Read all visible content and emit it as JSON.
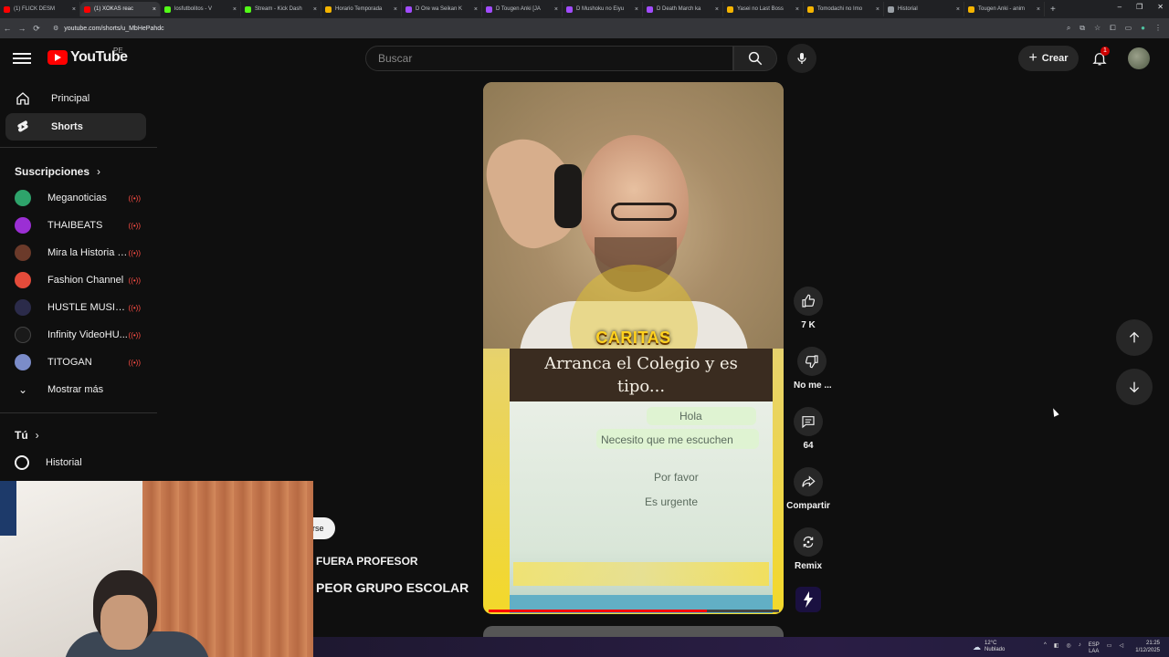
{
  "browser": {
    "tabs": [
      {
        "label": "(1) FLICK DESM",
        "color": "#ff0000"
      },
      {
        "label": "(1) XOKAS reac",
        "color": "#ff0000",
        "active": true
      },
      {
        "label": "losfutbolitos - V",
        "color": "#53fc18"
      },
      {
        "label": "Stream - Kick Dash",
        "color": "#53fc18"
      },
      {
        "label": "Horario Temporada",
        "color": "#f5b400"
      },
      {
        "label": "D Ore wa Seikan K",
        "color": "#a24cff"
      },
      {
        "label": "D Tougen Anki [JA",
        "color": "#a24cff"
      },
      {
        "label": "D Mushoku no Eiyu",
        "color": "#a24cff"
      },
      {
        "label": "D Death March ka",
        "color": "#a24cff"
      },
      {
        "label": "Yasei no Last Boss",
        "color": "#f5b400"
      },
      {
        "label": "Tomodachi no Imo",
        "color": "#f5b400"
      },
      {
        "label": "Historial",
        "color": "#9aa0a6"
      },
      {
        "label": "Tougen Anki - anim",
        "color": "#f5b400"
      }
    ],
    "url": "youtube.com/shorts/u_MbHePahdc",
    "window_controls": [
      "–",
      "❐",
      "✕"
    ]
  },
  "header": {
    "logo_text": "YouTube",
    "region": "PE",
    "search_placeholder": "Buscar",
    "create_label": "Crear",
    "notif_count": "1"
  },
  "sidebar": {
    "items": [
      {
        "label": "Principal",
        "icon": "home-icon"
      },
      {
        "label": "Shorts",
        "icon": "shorts-icon",
        "selected": true
      }
    ],
    "subs_heading": "Suscripciones",
    "subscriptions": [
      {
        "name": "Meganoticias",
        "color": "#2ea36b"
      },
      {
        "name": "THAIBEATS",
        "color": "#9b2fd4"
      },
      {
        "name": "Mira la Historia /...",
        "color": "#6b3a2a"
      },
      {
        "name": "Fashion Channel",
        "color": "#e44b3a"
      },
      {
        "name": "HUSTLE MUSIC (...",
        "color": "#2b2b4a"
      },
      {
        "name": "Infinity VideoHU...",
        "color": "#1a1a1a"
      },
      {
        "name": "TITOGAN",
        "color": "#7b8cc9"
      }
    ],
    "show_more": "Mostrar más",
    "you_heading": "Tú",
    "history_label": "Historial"
  },
  "short": {
    "overlay_title": "CARITAS",
    "caption_line1": "Arranca el Colegio y es",
    "caption_line2": "tipo...",
    "chat": {
      "msg1": "Hola",
      "msg2": "Necesito que me escuchen",
      "msg3": "Por favor",
      "msg4": "Es urgente"
    },
    "progress": 0.75
  },
  "actions": {
    "likes": "7 K",
    "dislike": "No me ...",
    "comments": "64",
    "share": "Compartir",
    "remix": "Remix"
  },
  "overlay": {
    "chip": "rse",
    "line1": "FUERA PROFESOR",
    "line2": "PEOR GRUPO ESCOLAR"
  },
  "taskbar": {
    "temp": "12°C",
    "weather": "Nublado",
    "lang1": "ESP",
    "lang2": "LAA",
    "time": "21:25",
    "date": "1/12/2025"
  }
}
